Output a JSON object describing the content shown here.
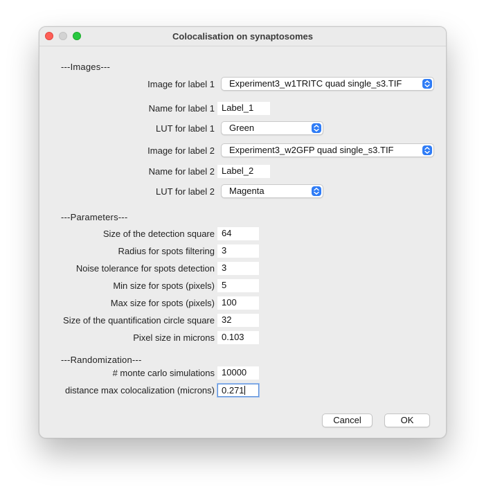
{
  "window": {
    "title": "Colocalisation on synaptosomes"
  },
  "sections": {
    "images": "---Images---",
    "parameters": "---Parameters---",
    "randomization": "---Randomization---"
  },
  "images": {
    "image1_label": "Image for label 1",
    "image1_value": "Experiment3_w1TRITC quad single_s3.TIF",
    "name1_label": "Name for label 1",
    "name1_value": "Label_1",
    "lut1_label": "LUT for label 1",
    "lut1_value": "Green",
    "image2_label": "Image for label 2",
    "image2_value": "Experiment3_w2GFP quad single_s3.TIF",
    "name2_label": "Name for label 2",
    "name2_value": "Label_2",
    "lut2_label": "LUT for label 2",
    "lut2_value": "Magenta"
  },
  "parameters": [
    {
      "label": "Size of the detection square",
      "value": "64"
    },
    {
      "label": "Radius for spots filtering",
      "value": "3"
    },
    {
      "label": "Noise tolerance for spots detection",
      "value": "3"
    },
    {
      "label": "Min size for spots (pixels)",
      "value": "5"
    },
    {
      "label": "Max size for spots (pixels)",
      "value": "100"
    },
    {
      "label": "Size of the quantification circle square",
      "value": "32"
    },
    {
      "label": "Pixel size in microns",
      "value": "0.103"
    }
  ],
  "randomization": {
    "monte_label": "# monte carlo simulations",
    "monte_value": "10000",
    "distance_label": "distance max colocalization (microns)",
    "distance_value": "0.271"
  },
  "buttons": {
    "cancel": "Cancel",
    "ok": "OK"
  },
  "colors": {
    "accent": "#2f7cf6",
    "close": "#fe5f57",
    "maximize": "#28c840"
  }
}
